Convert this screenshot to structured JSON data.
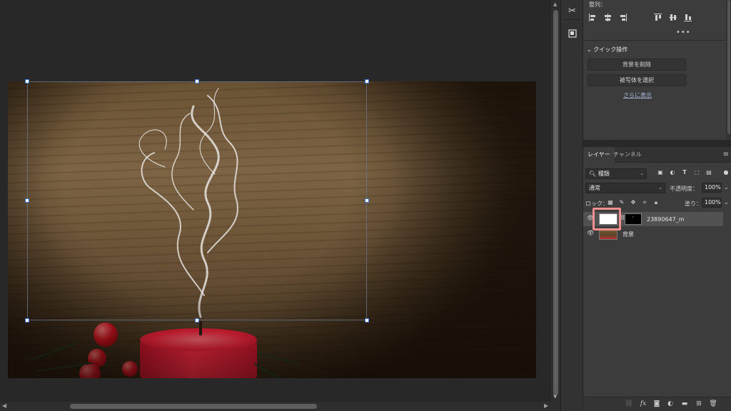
{
  "align_panel": {
    "label": "整列：",
    "more": "•••"
  },
  "quick_actions": {
    "title": "クイック操作",
    "remove_background": "背景を削除",
    "select_subject": "被写体を選択",
    "show_more": "さらに表示"
  },
  "layers_panel": {
    "tabs": [
      "レイヤー",
      "チャンネル"
    ],
    "filter_kind": "種類",
    "blend_mode": "通常",
    "opacity_label": "不透明度：",
    "opacity_value": "100%",
    "lock_label": "ロック：",
    "fill_label": "塗り：",
    "fill_value": "100%",
    "layers": [
      {
        "name": "23890647_m",
        "selected": true,
        "visible": true
      },
      {
        "name": "背景",
        "selected": false,
        "visible": true
      }
    ]
  },
  "icons": {
    "tool_1": "scissors-tool-icon",
    "tool_2": "properties-icon"
  },
  "colors": {
    "highlight": "#f08f8f",
    "candle": "#ff2945",
    "selection": "#ffffff"
  }
}
